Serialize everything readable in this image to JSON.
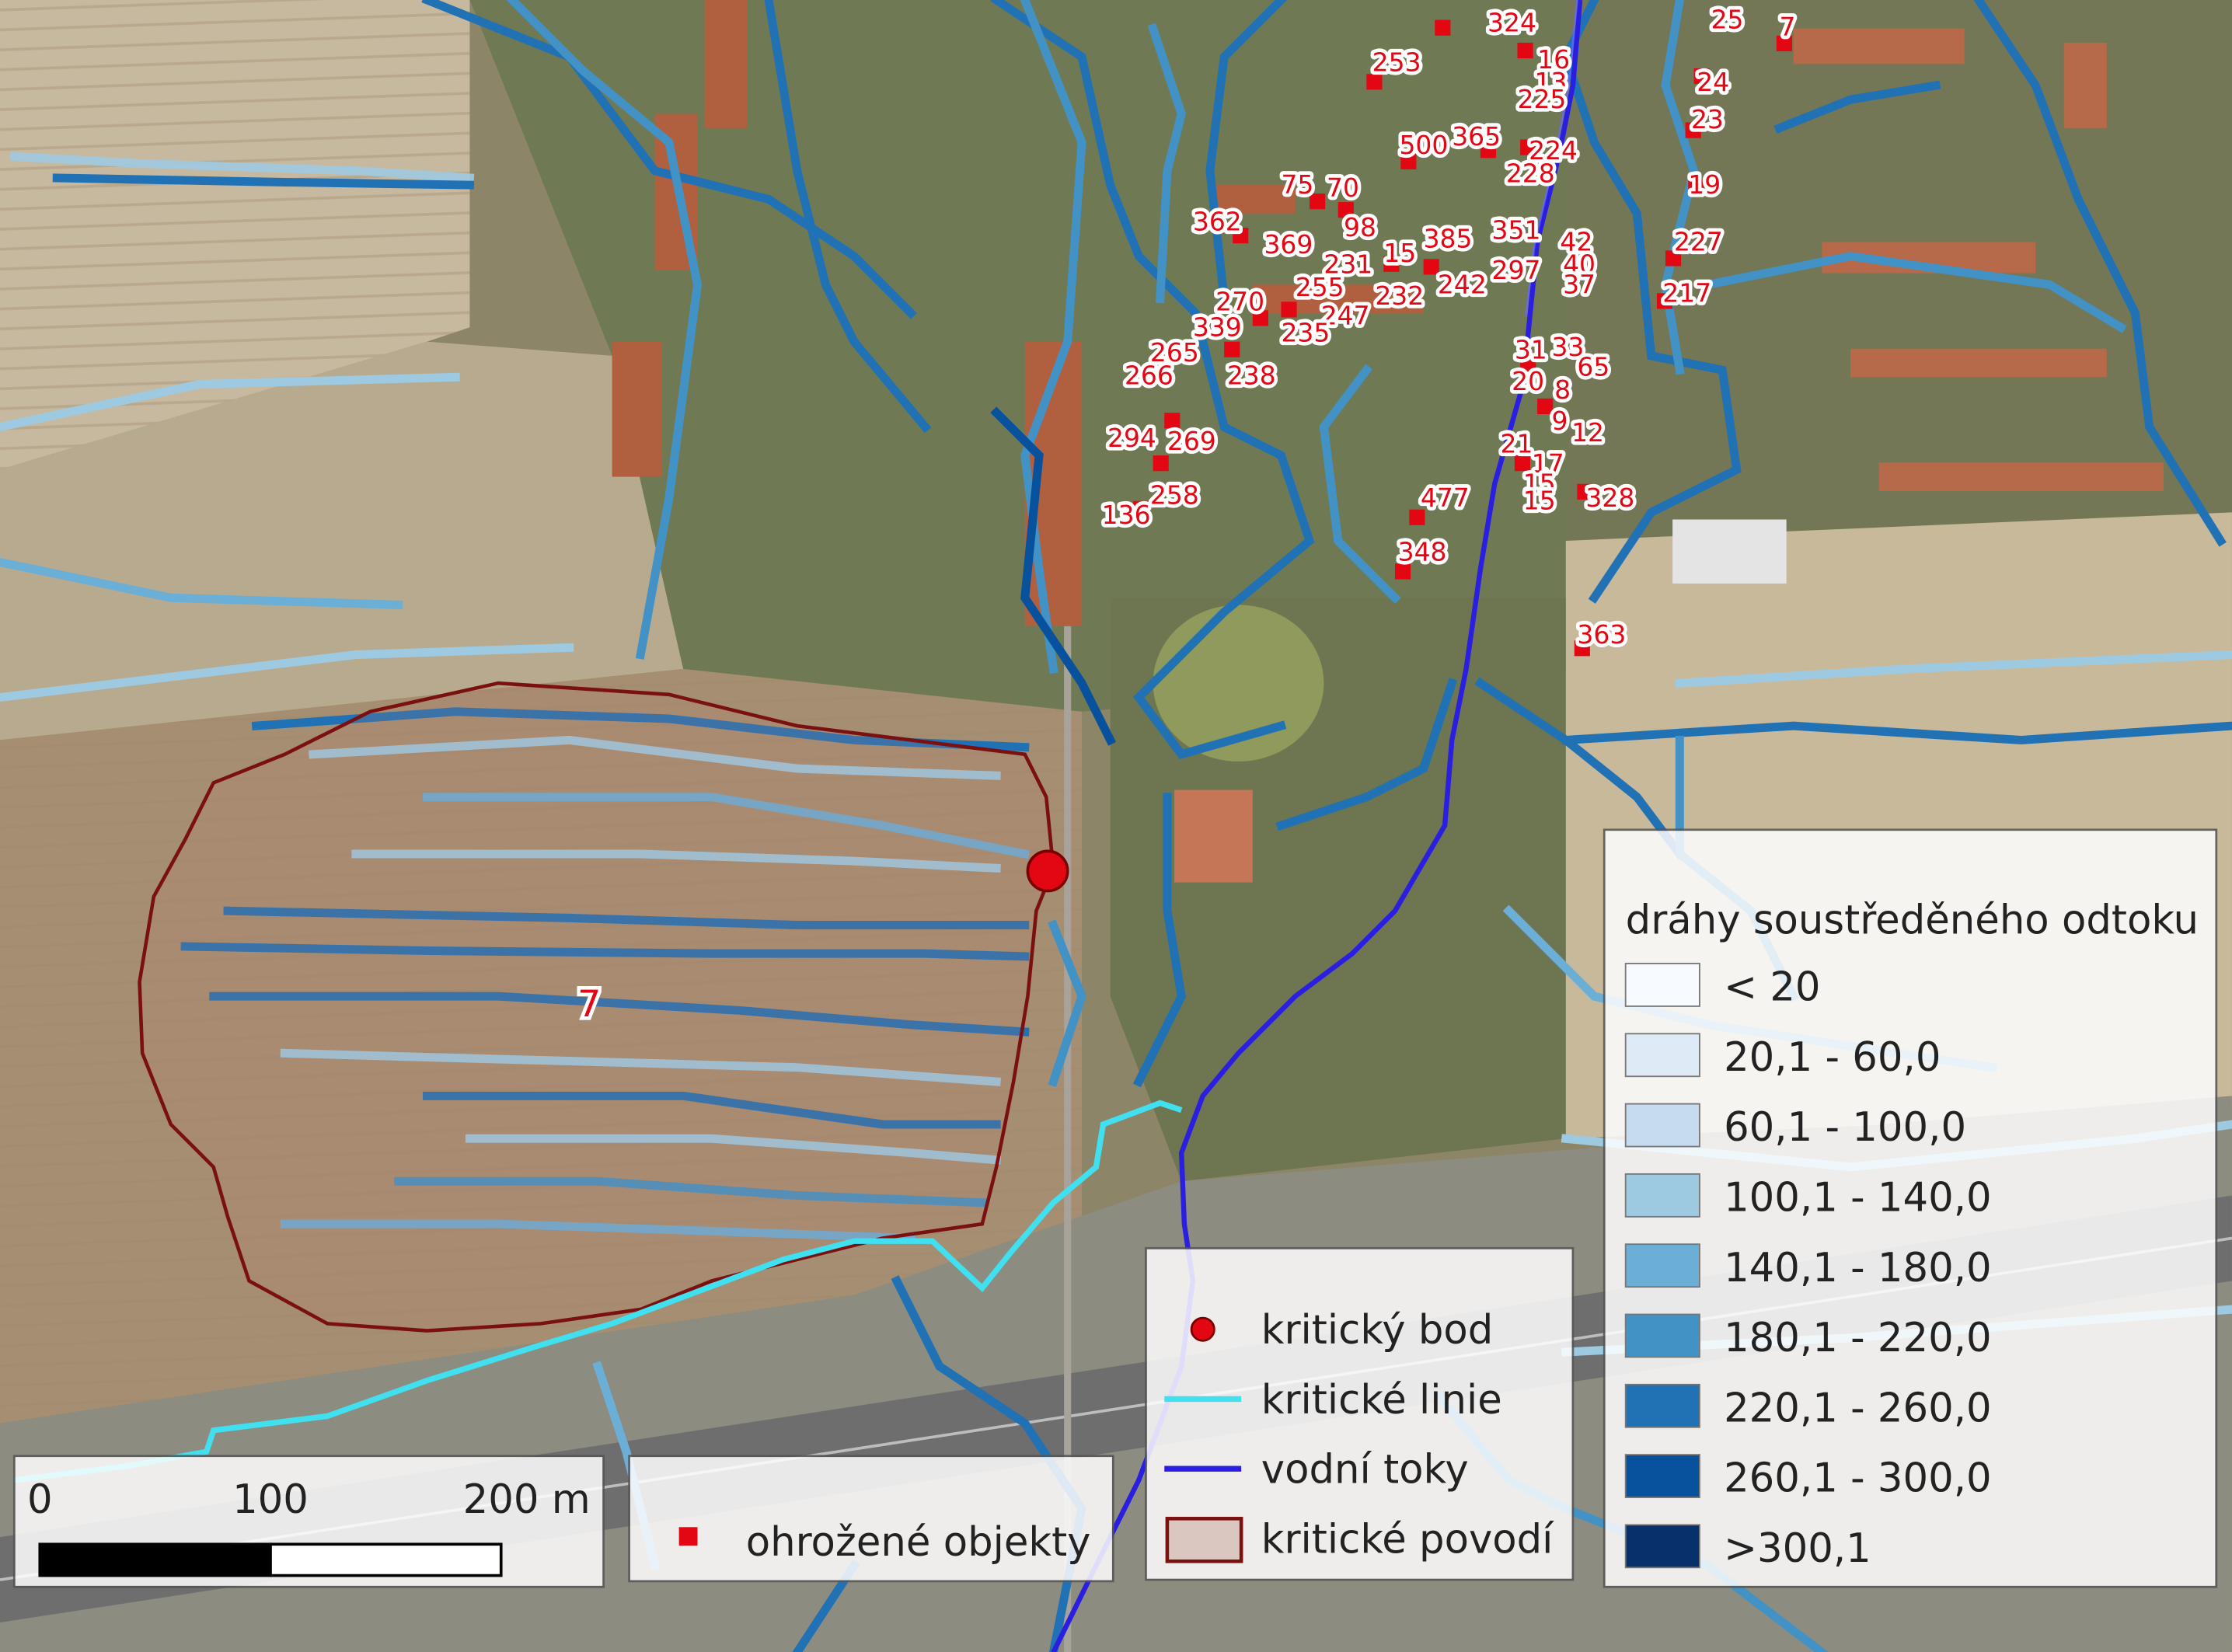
{
  "basin_label": "7",
  "scale_bar": {
    "ticks": [
      "0",
      "100",
      "200 m"
    ]
  },
  "legend_objects": {
    "label": "ohrožené objekty"
  },
  "legend_features": {
    "items": [
      {
        "name": "critical-point",
        "label": "kritický bod"
      },
      {
        "name": "critical-lines",
        "label": "kritické linie"
      },
      {
        "name": "watercourses",
        "label": "vodní toky"
      },
      {
        "name": "critical-basin",
        "label": "kritické povodí"
      }
    ]
  },
  "legend_flow": {
    "title": "dráhy soustředěného odtoku",
    "classes": [
      {
        "label": "< 20",
        "color": "#f7fbff"
      },
      {
        "label": "20,1 - 60,0",
        "color": "#deebf7"
      },
      {
        "label": "60,1 - 100,0",
        "color": "#c6dbef"
      },
      {
        "label": "100,1 - 140,0",
        "color": "#9ecae1"
      },
      {
        "label": "140,1 - 180,0",
        "color": "#6baed6"
      },
      {
        "label": "180,1 - 220,0",
        "color": "#4292c6"
      },
      {
        "label": "220,1 - 260,0",
        "color": "#2171b5"
      },
      {
        "label": "260,1 - 300,0",
        "color": "#08519c"
      },
      {
        "label": ">300,1",
        "color": "#08306b"
      }
    ]
  },
  "colors": {
    "critical_point": "#e30613",
    "critical_lines": "#40e0f0",
    "watercourses": "#2a1ee0",
    "basin_outline": "#7a1010",
    "object_marker": "#e30613"
  },
  "threatened_objects": [
    "324",
    "25",
    "7",
    "16",
    "13",
    "253",
    "225",
    "24",
    "23",
    "500",
    "365",
    "224",
    "228",
    "19",
    "75",
    "70",
    "362",
    "98",
    "369",
    "385",
    "351",
    "42",
    "231",
    "15",
    "297",
    "227",
    "40",
    "37",
    "255",
    "232",
    "242",
    "217",
    "270",
    "339",
    "247",
    "235",
    "31",
    "33",
    "265",
    "238",
    "266",
    "65",
    "20",
    "8",
    "9",
    "12",
    "294",
    "269",
    "21",
    "17",
    "15",
    "15",
    "258",
    "477",
    "328",
    "136",
    "348",
    "363"
  ]
}
